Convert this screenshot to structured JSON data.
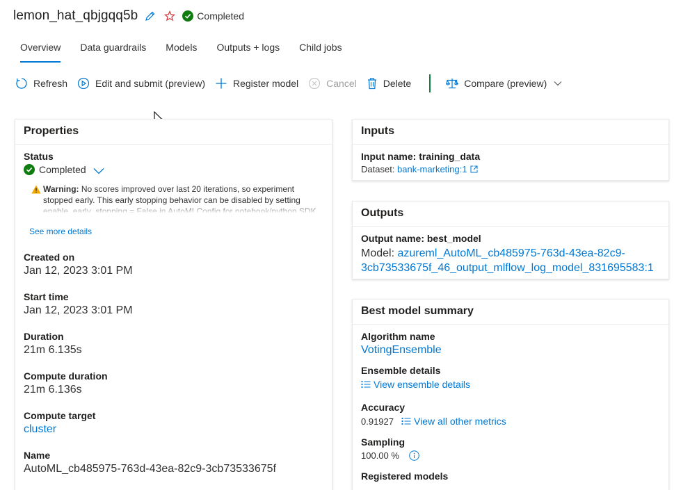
{
  "header": {
    "title": "lemon_hat_qbjgqq5b",
    "status": "Completed",
    "edit_icon": "pencil-icon",
    "favorite_icon": "star-outline-icon"
  },
  "tabs": [
    {
      "label": "Overview",
      "active": true
    },
    {
      "label": "Data guardrails",
      "active": false
    },
    {
      "label": "Models",
      "active": false
    },
    {
      "label": "Outputs + logs",
      "active": false
    },
    {
      "label": "Child jobs",
      "active": false
    }
  ],
  "toolbar": {
    "refresh": "Refresh",
    "edit_submit": "Edit and submit (preview)",
    "register_model": "Register model",
    "cancel": "Cancel",
    "delete": "Delete",
    "compare": "Compare (preview)"
  },
  "properties": {
    "title": "Properties",
    "status_label": "Status",
    "status_value": "Completed",
    "warning_title": "Warning:",
    "warning_text": " No scores improved over last 20 iterations, so experiment stopped early. This early stopping behavior can be disabled by setting enable_early_stopping = False in AutoMLConfig for notebook/python SDK",
    "see_more": "See more details",
    "created_label": "Created on",
    "created_value": "Jan 12, 2023 3:01 PM",
    "start_label": "Start time",
    "start_value": "Jan 12, 2023 3:01 PM",
    "duration_label": "Duration",
    "duration_value": "21m 6.135s",
    "compute_duration_label": "Compute duration",
    "compute_duration_value": "21m 6.136s",
    "compute_target_label": "Compute target",
    "compute_target_value": "cluster",
    "name_label": "Name",
    "name_value": "AutoML_cb485975-763d-43ea-82c9-3cb73533675f"
  },
  "inputs": {
    "title": "Inputs",
    "input_name": "Input name: training_data",
    "dataset_label": "Dataset: ",
    "dataset_value": "bank-marketing:1"
  },
  "outputs": {
    "title": "Outputs",
    "output_name": "Output name: best_model",
    "model_label": "Model: ",
    "model_value": "azureml_AutoML_cb485975-763d-43ea-82c9-3cb73533675f_46_output_mlflow_log_model_831695583:1"
  },
  "best_model": {
    "title": "Best model summary",
    "algorithm_label": "Algorithm name",
    "algorithm_value": "VotingEnsemble",
    "ensemble_label": "Ensemble details",
    "ensemble_link": "View ensemble details",
    "accuracy_label": "Accuracy",
    "accuracy_value": "0.91927",
    "metrics_link": "View all other metrics",
    "sampling_label": "Sampling",
    "sampling_value": "100.00 %",
    "next_label": "Registered models"
  },
  "colors": {
    "accent": "#0078d4",
    "success": "#107c10",
    "warning": "#f2a900",
    "favorite": "#d13438"
  }
}
